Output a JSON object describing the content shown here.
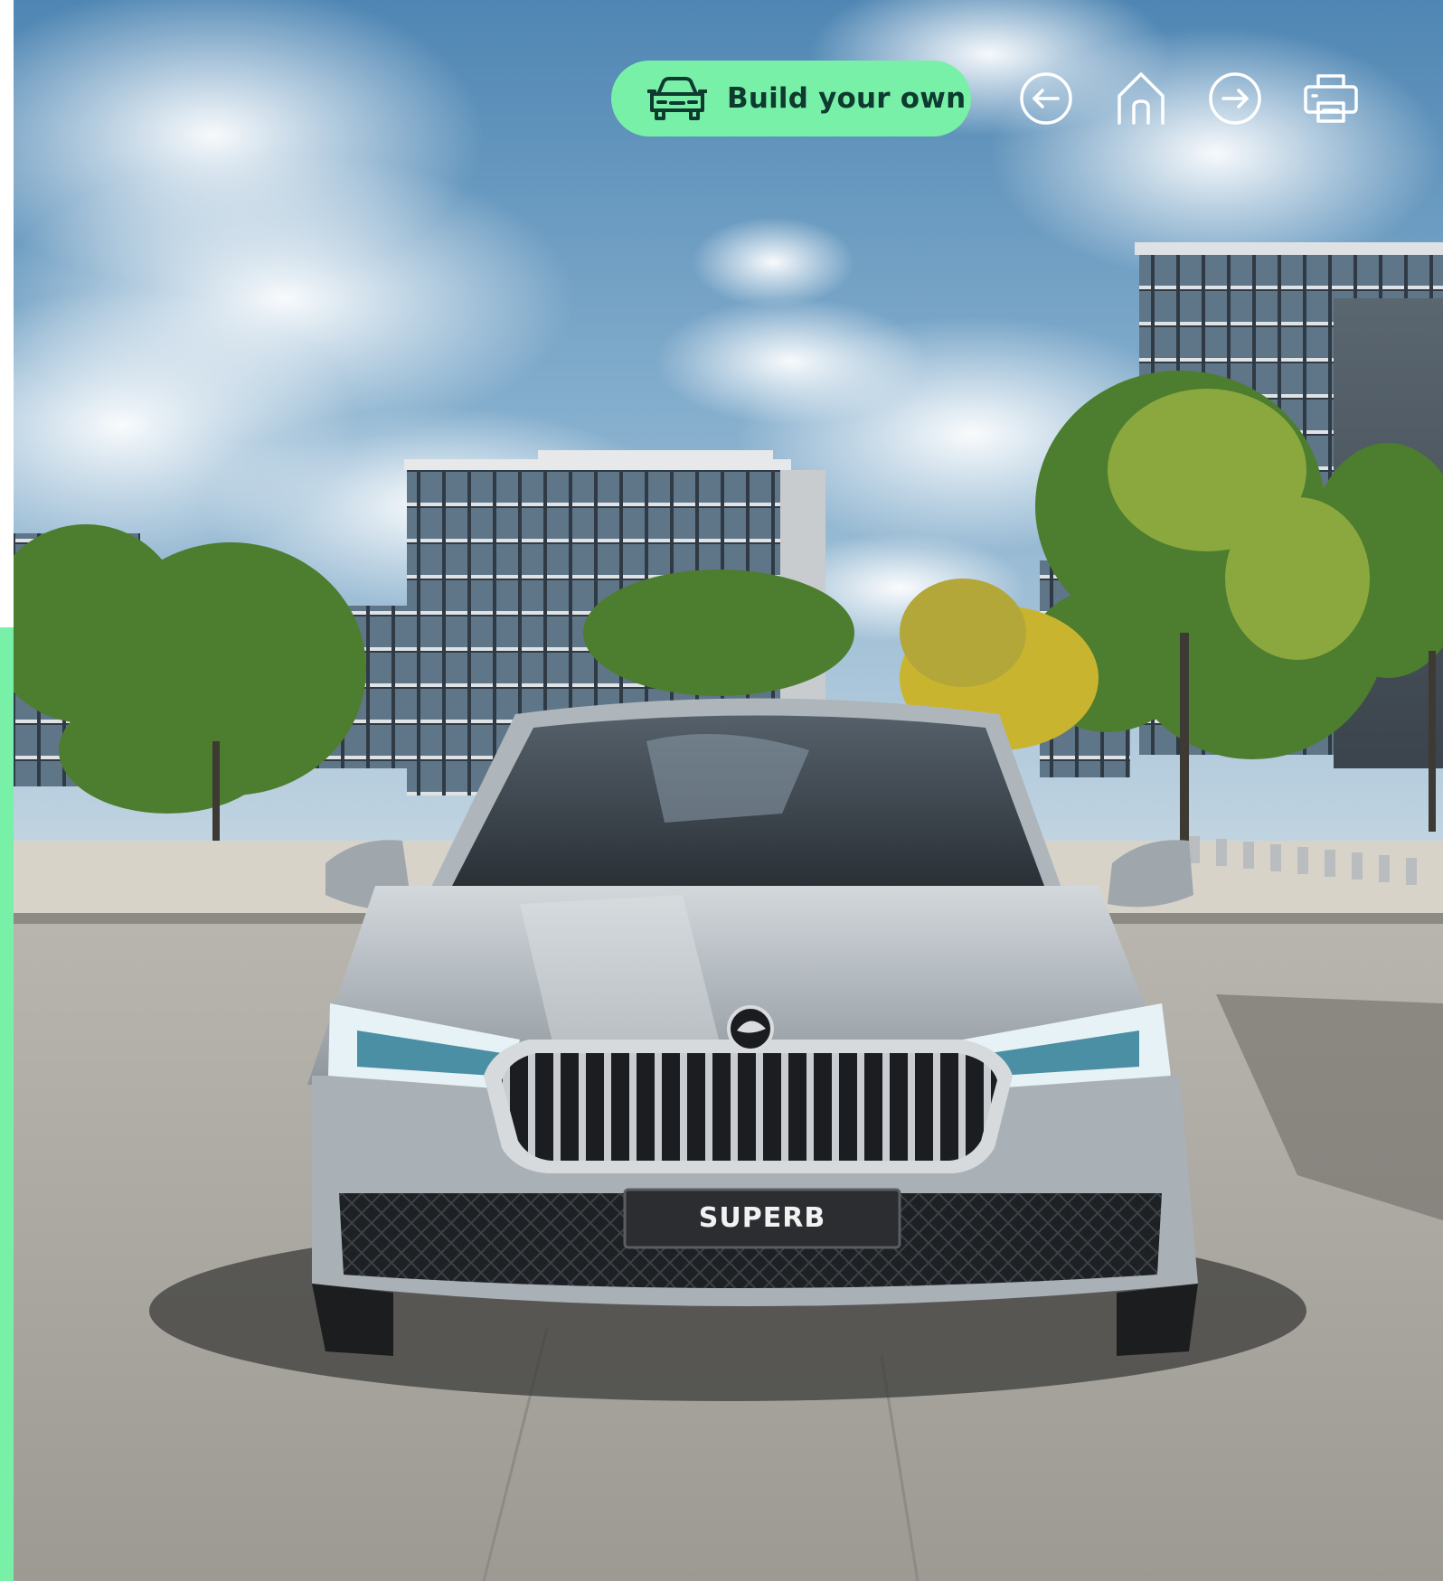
{
  "toolbar": {
    "build_button": {
      "label": "Build your own",
      "icon": "car-front-icon"
    },
    "nav": [
      {
        "name": "back",
        "icon": "arrow-left-icon"
      },
      {
        "name": "home",
        "icon": "home-icon"
      },
      {
        "name": "forward",
        "icon": "arrow-right-icon"
      },
      {
        "name": "print",
        "icon": "printer-icon"
      }
    ]
  },
  "hero": {
    "license_plate": "SUPERB",
    "badge_icon": "brand-logo-icon"
  },
  "colors": {
    "accent": "#78f0a8",
    "button_text": "#0e3a2f",
    "icon_stroke": "#ffffff",
    "sky": "#6a9ec4",
    "car_body": "#b7bec4",
    "pavement": "#a8a6a1"
  }
}
